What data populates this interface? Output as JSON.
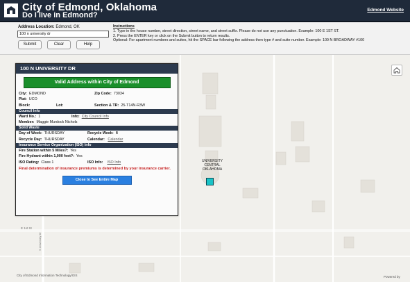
{
  "header": {
    "title": "City of Edmond, Oklahoma",
    "subtitle": "Do I live in Edmond?",
    "link": "Edmond Website"
  },
  "search": {
    "location_label": "Address Location:",
    "location_value": "Edmond, OK",
    "input_value": "100 n university dr",
    "submit": "Submit",
    "clear": "Clear",
    "help": "Help"
  },
  "instructions": {
    "title": "Instructions",
    "line1": "1. Type in the house number, street direction, street name, and street suffix. Please do not use any punctuation. Example: 100 E 1ST ST.",
    "line2": "2. Press the ENTER key or click on the Submit button to return results.",
    "line3": "Optional: For apartment numbers and suites, hit the SPACE bar following the address then type # and suite number. Example: 100 N BROADWAY #100"
  },
  "panel": {
    "title": "100 N UNIVERSITY DR",
    "banner": "Valid Address within City of Edmond",
    "city_label": "City:",
    "city": "EDMOND",
    "zip_label": "Zip Code:",
    "zip": "73034",
    "plat_label": "Plat:",
    "plat": "UCO",
    "block_label": "Block:",
    "block": "",
    "lot_label": "Lot:",
    "lot": "",
    "section_label": "Section & TR:",
    "section": "25-T14N-R3W",
    "council_header": "Council Info",
    "ward_label": "Ward No.:",
    "ward": "1",
    "info_label": "Info:",
    "council_link": "City Council Info",
    "member_label": "Member:",
    "member": "Maggie Murdock Nichols",
    "solid_header": "Solid Waste",
    "day_label": "Day of Week:",
    "day": "THURSDAY",
    "recycle_week_label": "Recycle Week:",
    "recycle_week": "B",
    "recycle_day_label": "Recycle Day:",
    "recycle_day": "THURSDAY",
    "calendar_label": "Calendar:",
    "calendar_link": "Calendar",
    "iso_header": "Insurance Service Organization (ISO) Info",
    "fire_station_label": "Fire Station within 5 Miles?:",
    "fire_station": "Yes",
    "fire_hydrant_label": "Fire Hydrant within 1,000 feet?:",
    "fire_hydrant": "Yes",
    "iso_rating_label": "ISO Rating:",
    "iso_rating": "Class 1",
    "iso_info_label": "ISO Info:",
    "iso_link": "ISO Info",
    "warning": "Final determination of insurance premiums is determined by your insurance carrier.",
    "close": "Close to See Entire Map"
  },
  "map": {
    "campus_label_1": "UNIVERSITY",
    "campus_label_2": "CENTRAL",
    "campus_label_3": "OKLAHOMA",
    "street_1": "E 1st St",
    "street_2": "S University Dr",
    "attribution": "City of Edmond Information Technology/GIS",
    "powered": "Powered by"
  },
  "colors": {
    "header_bg": "#1f2a3a",
    "banner_green": "#1a8f2b",
    "marker": "#19c3c7",
    "warning_red": "#c62020"
  },
  "icons": [
    "home-icon",
    "city-logo-icon"
  ]
}
